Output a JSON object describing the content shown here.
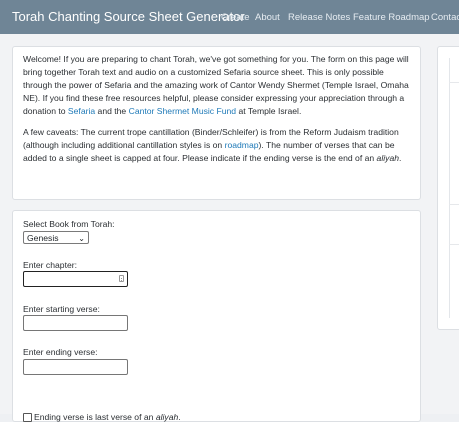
{
  "navbar": {
    "brand": "Torah Chanting Source Sheet Generator",
    "links": [
      "Create",
      "About",
      "Release Notes",
      "Feature Roadmap",
      "Contact"
    ]
  },
  "intro": {
    "p1_a": "Welcome! If you are preparing to chant Torah, we've got something for you. The form on this page will bring together Torah text and audio on a customized Sefaria source sheet. This is only possible through the power of Sefaria and the amazing work of Cantor Wendy Shermet (Temple Israel, Omaha NE). If you find these free resources helpful, please consider expressing your appreciation through a donation to ",
    "p1_link1": "Sefaria",
    "p1_b": " and the ",
    "p1_link2": "Cantor Shermet Music Fund",
    "p1_c": " at Temple Israel.",
    "p2_a": "A few caveats: The current trope cantillation (Binder/Schleifer) is from the Reform Judaism tradition (although including additional cantillation styles is on ",
    "p2_link": "roadmap",
    "p2_b": "). The number of verses that can be added to a single sheet is capped at four. Please indicate if the ending verse is the end of an ",
    "p2_em": "aliyah",
    "p2_c": "."
  },
  "form": {
    "book_label": "Select Book from Torah:",
    "book_selected": "Genesis",
    "chapter_label": "Enter chapter:",
    "chapter_value": "",
    "start_label": "Enter starting verse:",
    "start_value": "",
    "end_label": "Enter ending verse:",
    "end_value": "",
    "aliyah_label_a": "Ending verse is last verse of an ",
    "aliyah_label_em": "aliyah",
    "aliyah_label_b": ".",
    "aliyah_checked": false
  }
}
